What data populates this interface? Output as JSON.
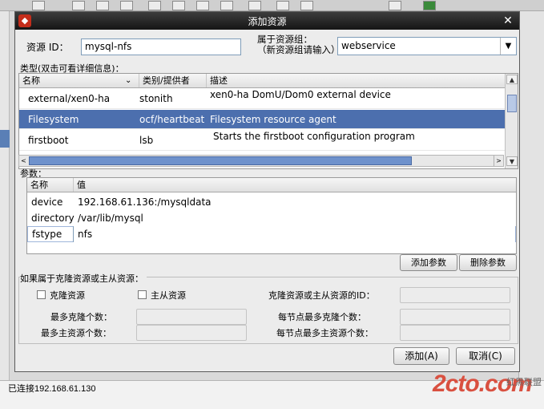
{
  "background": {
    "status_text": "已连接192.168.61.130",
    "watermark_main": "2cto.com",
    "watermark_sub": "红黑联盟"
  },
  "dialog": {
    "title": "添加资源",
    "resource_id_label": "资源 ID：",
    "resource_id_value": "mysql-nfs",
    "group_label_line1": "属于资源组：",
    "group_label_line2": "（新资源组请输入）",
    "group_value": "webservice",
    "type_section_label": "类型(双击可看详细信息)：",
    "type_table": {
      "headers": [
        "名称",
        "类别/提供者",
        "描述"
      ],
      "rows": [
        {
          "name": "external/xen0-ha",
          "provider": "stonith",
          "desc": "xen0-ha DomU/Dom0 external device",
          "selected": false
        },
        {
          "name": "Filesystem",
          "provider": "ocf/heartbeat",
          "desc": "Filesystem resource agent",
          "selected": true
        },
        {
          "name": "firstboot",
          "provider": "lsb",
          "desc": "Starts the firstboot configuration program",
          "selected": false
        }
      ]
    },
    "params_section_label": "参数：",
    "params_table": {
      "headers": [
        "名称",
        "值"
      ],
      "rows": [
        {
          "name": "device",
          "value": "192.168.61.136:/mysqldata"
        },
        {
          "name": "directory",
          "value": "/var/lib/mysql"
        },
        {
          "name": "fstype",
          "value": "nfs"
        }
      ]
    },
    "add_param_button": "添加参数",
    "delete_param_button": "删除参数",
    "clone_section_label": "如果属于克隆资源或主从资源：",
    "clone_checkbox_label": "克隆资源",
    "master_checkbox_label": "主从资源",
    "clone_master_id_label": "克隆资源或主从资源的ID：",
    "max_clones_label": "最多克隆个数：",
    "max_masters_label": "最多主资源个数：",
    "clone_node_max_label": "每节点最多克隆个数：",
    "master_node_max_label": "每节点最多主资源个数：",
    "add_button": "添加(A)",
    "cancel_button": "取消(C)"
  }
}
